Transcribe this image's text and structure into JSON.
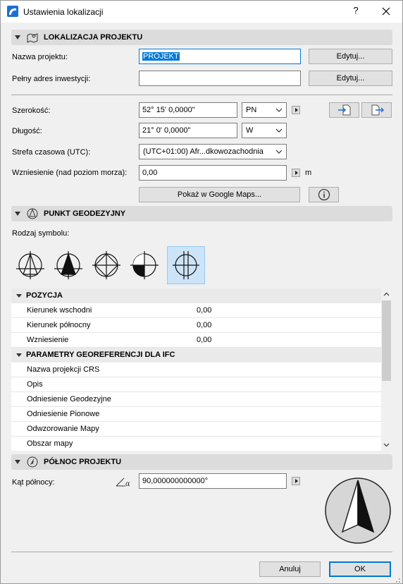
{
  "window": {
    "title": "Ustawienia lokalizacji",
    "help_label": "?",
    "close_label": "×"
  },
  "project_location": {
    "title": "LOKALIZACJA PROJEKTU",
    "name_label": "Nazwa projektu:",
    "name_value": "PROJEKT",
    "edit_label": "Edytuj...",
    "address_label": "Pełny adres inwestycji:",
    "address_value": "",
    "edit2_label": "Edytuj..."
  },
  "coordinates": {
    "latitude_label": "Szerokość:",
    "latitude_value": "52° 15' 0,0000\"",
    "latitude_dir": "PN",
    "longitude_label": "Długość:",
    "longitude_value": "21° 0' 0,0000\"",
    "longitude_dir": "W",
    "timezone_label": "Strefa czasowa (UTC):",
    "timezone_value": "(UTC+01:00) Afr...dkowozachodnia",
    "elevation_label": "Wzniesienie (nad poziom morza):",
    "elevation_value": "0,00",
    "elevation_unit": "m",
    "google_maps_label": "Pokaż w Google Maps..."
  },
  "survey_point": {
    "title": "PUNKT GEODEZYJNY",
    "symbol_label": "Rodzaj symbolu:",
    "symbols": [
      "survey-symbol-1",
      "survey-symbol-2",
      "survey-symbol-3",
      "survey-symbol-4",
      "survey-symbol-5"
    ],
    "selected_index": 4
  },
  "grid": {
    "position_title": "POZYCJA",
    "position_rows": [
      {
        "key": "Kierunek wschodni",
        "value": "0,00"
      },
      {
        "key": "Kierunek północny",
        "value": "0,00"
      },
      {
        "key": "Wzniesienie",
        "value": "0,00"
      }
    ],
    "ifc_title": "PARAMETRY GEOREFERENCJI DLA IFC",
    "ifc_rows": [
      {
        "key": "Nazwa projekcji CRS"
      },
      {
        "key": "Opis"
      },
      {
        "key": "Odniesienie Geodezyjne"
      },
      {
        "key": "Odniesienie Pionowe"
      },
      {
        "key": "Odwzorowanie Mapy"
      },
      {
        "key": "Obszar mapy"
      }
    ]
  },
  "north": {
    "title": "PÓŁNOC PROJEKTU",
    "angle_label": "Kąt północy:",
    "angle_value": "90,000000000000°"
  },
  "footer": {
    "cancel_label": "Anuluj",
    "ok_label": "OK"
  },
  "colors": {
    "accent": "#0078d7",
    "selection_bg": "#cce4f7"
  }
}
